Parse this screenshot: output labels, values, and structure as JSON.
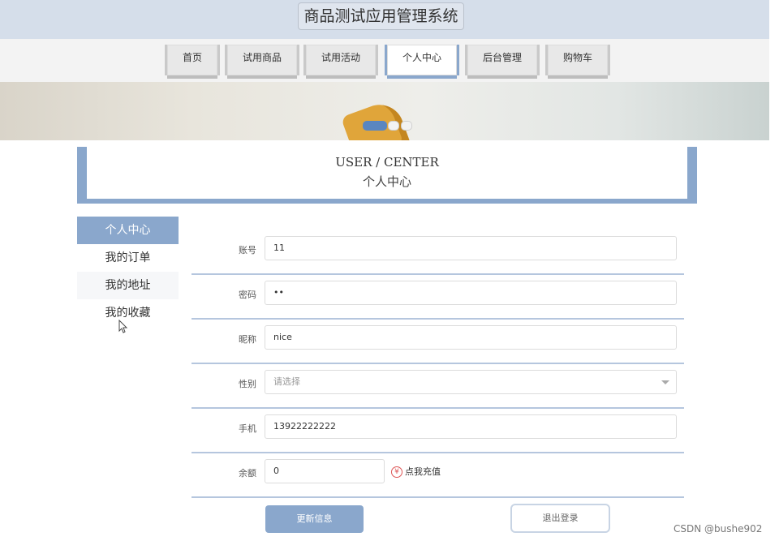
{
  "header": {
    "title": "商品测试应用管理系统"
  },
  "nav": {
    "items": [
      {
        "label": "首页"
      },
      {
        "label": "试用商品"
      },
      {
        "label": "试用活动"
      },
      {
        "label": "个人中心"
      },
      {
        "label": "后台管理"
      },
      {
        "label": "购物车"
      }
    ],
    "active_index": 3
  },
  "banner": {
    "carousel_total": 3,
    "carousel_active": 1
  },
  "center": {
    "title_en": "USER / CENTER",
    "title_cn": "个人中心"
  },
  "sidebar": {
    "items": [
      {
        "label": "个人中心"
      },
      {
        "label": "我的订单"
      },
      {
        "label": "我的地址"
      },
      {
        "label": "我的收藏"
      }
    ],
    "active_index": 0
  },
  "form": {
    "account": {
      "label": "账号",
      "value": "11"
    },
    "password": {
      "label": "密码",
      "value": "••"
    },
    "nickname": {
      "label": "昵称",
      "value": "nice"
    },
    "gender": {
      "label": "性别",
      "placeholder": "请选择"
    },
    "phone": {
      "label": "手机",
      "value": "13922222222"
    },
    "balance": {
      "label": "余额",
      "value": "0",
      "recharge_label": "点我充值",
      "recharge_icon": "¥"
    }
  },
  "buttons": {
    "update": "更新信息",
    "logout": "退出登录"
  },
  "watermark": "CSDN @bushe902",
  "colors": {
    "accent": "#8aa7cc",
    "header_bg": "#d5deea"
  }
}
